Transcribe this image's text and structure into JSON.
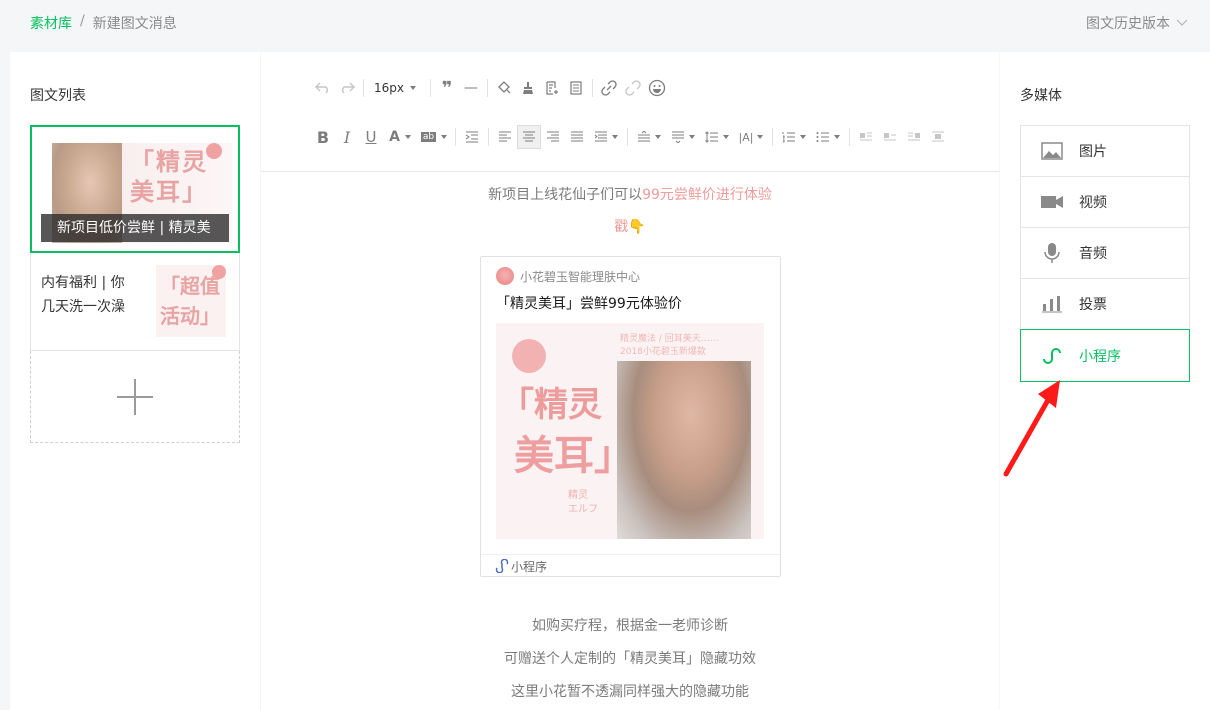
{
  "breadcrumb": {
    "root": "素材库",
    "separator": "/",
    "current": "新建图文消息"
  },
  "history": {
    "label": "图文历史版本"
  },
  "left_panel": {
    "title": "图文列表",
    "articles": [
      {
        "caption": "新项目低价尝鲜 | 精灵美",
        "cover_text": "「精灵\n美耳」"
      },
      {
        "title": "内有福利 | 你几天洗一次澡",
        "cover_text": "「超值\n活动」"
      }
    ]
  },
  "toolbar": {
    "font_size": "16px",
    "row1_icons": [
      "undo-icon",
      "redo-icon",
      "quote-icon",
      "horizontal-rule-icon",
      "format-painter-icon",
      "clear-format-icon",
      "insert-template-icon",
      "paste-icon",
      "link-icon",
      "unlink-icon",
      "emoji-icon"
    ],
    "row2_icons": [
      "bold-icon",
      "italic-icon",
      "underline-icon",
      "font-color-icon",
      "background-color-icon",
      "indent-icon",
      "align-left-icon",
      "align-center-icon",
      "align-right-icon",
      "align-justify-icon",
      "list-spacing-icon",
      "line-height-icon",
      "paragraph-before-icon",
      "paragraph-after-icon",
      "letter-spacing-icon",
      "ordered-list-icon",
      "unordered-list-icon",
      "float-left-icon",
      "float-none-icon",
      "float-right-icon",
      "float-center-icon"
    ]
  },
  "content": {
    "line1_prefix": "新项目上线花仙子们可以",
    "line1_highlight": "99元尝鲜价进行体验",
    "line2": "戳👇",
    "miniprogram_card": {
      "source": "小花碧玉智能理肤中心",
      "title": "「精灵美耳」尝鲜99元体验价",
      "poster_small_text": "精灵魔法 / 回耳美天……\n2018小花碧玉新爆款",
      "poster_big1": "「精灵",
      "poster_big2": "美耳」",
      "poster_sig": "精灵\nエルフ",
      "footer": "小程序"
    },
    "para1": "如购买疗程，根据金一老师诊断",
    "para2": "可赠送个人定制的「精灵美耳」隐藏功效",
    "para3": "这里小花暂不透漏同样强大的隐藏功能"
  },
  "right_panel": {
    "title": "多媒体",
    "items": [
      {
        "label": "图片",
        "icon": "image-icon"
      },
      {
        "label": "视频",
        "icon": "video-icon"
      },
      {
        "label": "音频",
        "icon": "microphone-icon"
      },
      {
        "label": "投票",
        "icon": "poll-icon"
      },
      {
        "label": "小程序",
        "icon": "miniprogram-icon",
        "active": true
      }
    ]
  },
  "colors": {
    "accent": "#07c160",
    "highlight": "#f39a9a",
    "annotation_arrow": "#ff1a1a"
  }
}
